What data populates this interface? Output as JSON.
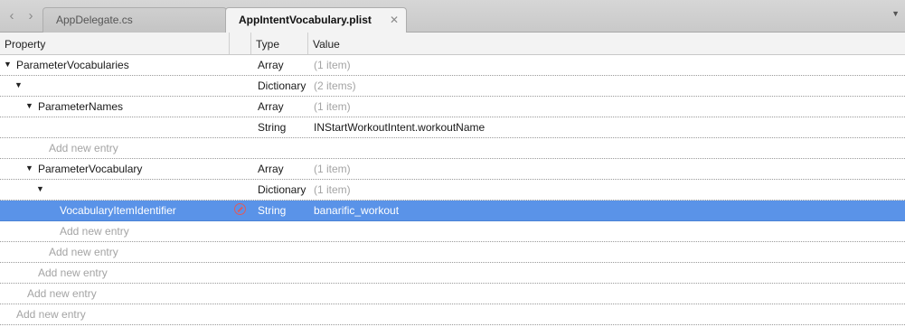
{
  "nav": {
    "back_glyph": "‹",
    "forward_glyph": "›"
  },
  "tabs": [
    {
      "label": "AppDelegate.cs",
      "active": false
    },
    {
      "label": "AppIntentVocabulary.plist",
      "active": true,
      "close_glyph": "✕"
    }
  ],
  "tab_menu_glyph": "▼",
  "table": {
    "columns": {
      "property": "Property",
      "type": "Type",
      "value": "Value"
    },
    "rows": [
      {
        "key": "ParameterVocabularies",
        "type": "Array",
        "value": "(1 item)"
      },
      {
        "key": "",
        "type": "Dictionary",
        "value": "(2 items)"
      },
      {
        "key": "ParameterNames",
        "type": "Array",
        "value": "(1 item)"
      },
      {
        "key": "",
        "type": "String",
        "value": "INStartWorkoutIntent.workoutName"
      },
      {
        "key": "Add new entry",
        "type": "",
        "value": ""
      },
      {
        "key": "ParameterVocabulary",
        "type": "Array",
        "value": "(1 item)"
      },
      {
        "key": "",
        "type": "Dictionary",
        "value": "(1 item)"
      },
      {
        "key": "VocabularyItemIdentifier",
        "type": "String",
        "value": "banarific_workout",
        "selected": true
      },
      {
        "key": "Add new entry",
        "type": "",
        "value": ""
      },
      {
        "key": "Add new entry",
        "type": "",
        "value": ""
      },
      {
        "key": "Add new entry",
        "type": "",
        "value": ""
      },
      {
        "key": "Add new entry",
        "type": "",
        "value": ""
      },
      {
        "key": "Add new entry",
        "type": "",
        "value": ""
      }
    ]
  },
  "colors": {
    "selection": "#5a93e8",
    "placeholder": "#a4a4a4",
    "remove": "#e05a5a"
  }
}
